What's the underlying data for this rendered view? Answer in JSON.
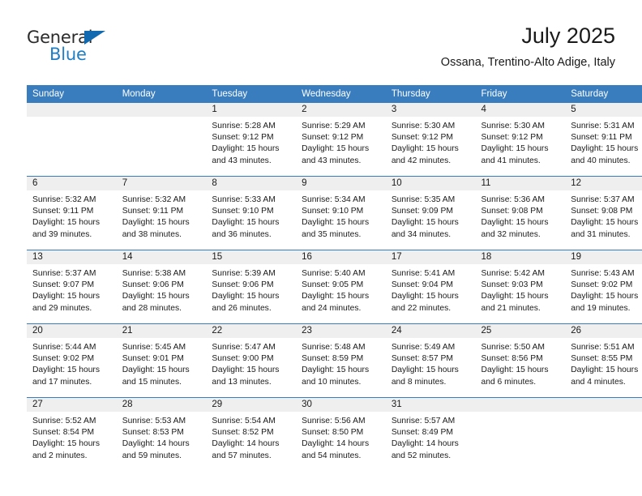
{
  "logo": {
    "word1": "General",
    "word2": "Blue",
    "triangle_color": "#1169b0",
    "blue_color": "#1f7ec4"
  },
  "header": {
    "title": "July 2025",
    "subtitle": "Ossana, Trentino-Alto Adige, Italy"
  },
  "theme": {
    "header_band": "#3a7dbf",
    "daynum_band": "#efefef",
    "text": "#1a1a1a"
  },
  "weekdays": [
    "Sunday",
    "Monday",
    "Tuesday",
    "Wednesday",
    "Thursday",
    "Friday",
    "Saturday"
  ],
  "weeks": [
    [
      {
        "day": "",
        "lines": []
      },
      {
        "day": "",
        "lines": []
      },
      {
        "day": "1",
        "lines": [
          "Sunrise: 5:28 AM",
          "Sunset: 9:12 PM",
          "Daylight: 15 hours and 43 minutes."
        ]
      },
      {
        "day": "2",
        "lines": [
          "Sunrise: 5:29 AM",
          "Sunset: 9:12 PM",
          "Daylight: 15 hours and 43 minutes."
        ]
      },
      {
        "day": "3",
        "lines": [
          "Sunrise: 5:30 AM",
          "Sunset: 9:12 PM",
          "Daylight: 15 hours and 42 minutes."
        ]
      },
      {
        "day": "4",
        "lines": [
          "Sunrise: 5:30 AM",
          "Sunset: 9:12 PM",
          "Daylight: 15 hours and 41 minutes."
        ]
      },
      {
        "day": "5",
        "lines": [
          "Sunrise: 5:31 AM",
          "Sunset: 9:11 PM",
          "Daylight: 15 hours and 40 minutes."
        ]
      }
    ],
    [
      {
        "day": "6",
        "lines": [
          "Sunrise: 5:32 AM",
          "Sunset: 9:11 PM",
          "Daylight: 15 hours and 39 minutes."
        ]
      },
      {
        "day": "7",
        "lines": [
          "Sunrise: 5:32 AM",
          "Sunset: 9:11 PM",
          "Daylight: 15 hours and 38 minutes."
        ]
      },
      {
        "day": "8",
        "lines": [
          "Sunrise: 5:33 AM",
          "Sunset: 9:10 PM",
          "Daylight: 15 hours and 36 minutes."
        ]
      },
      {
        "day": "9",
        "lines": [
          "Sunrise: 5:34 AM",
          "Sunset: 9:10 PM",
          "Daylight: 15 hours and 35 minutes."
        ]
      },
      {
        "day": "10",
        "lines": [
          "Sunrise: 5:35 AM",
          "Sunset: 9:09 PM",
          "Daylight: 15 hours and 34 minutes."
        ]
      },
      {
        "day": "11",
        "lines": [
          "Sunrise: 5:36 AM",
          "Sunset: 9:08 PM",
          "Daylight: 15 hours and 32 minutes."
        ]
      },
      {
        "day": "12",
        "lines": [
          "Sunrise: 5:37 AM",
          "Sunset: 9:08 PM",
          "Daylight: 15 hours and 31 minutes."
        ]
      }
    ],
    [
      {
        "day": "13",
        "lines": [
          "Sunrise: 5:37 AM",
          "Sunset: 9:07 PM",
          "Daylight: 15 hours and 29 minutes."
        ]
      },
      {
        "day": "14",
        "lines": [
          "Sunrise: 5:38 AM",
          "Sunset: 9:06 PM",
          "Daylight: 15 hours and 28 minutes."
        ]
      },
      {
        "day": "15",
        "lines": [
          "Sunrise: 5:39 AM",
          "Sunset: 9:06 PM",
          "Daylight: 15 hours and 26 minutes."
        ]
      },
      {
        "day": "16",
        "lines": [
          "Sunrise: 5:40 AM",
          "Sunset: 9:05 PM",
          "Daylight: 15 hours and 24 minutes."
        ]
      },
      {
        "day": "17",
        "lines": [
          "Sunrise: 5:41 AM",
          "Sunset: 9:04 PM",
          "Daylight: 15 hours and 22 minutes."
        ]
      },
      {
        "day": "18",
        "lines": [
          "Sunrise: 5:42 AM",
          "Sunset: 9:03 PM",
          "Daylight: 15 hours and 21 minutes."
        ]
      },
      {
        "day": "19",
        "lines": [
          "Sunrise: 5:43 AM",
          "Sunset: 9:02 PM",
          "Daylight: 15 hours and 19 minutes."
        ]
      }
    ],
    [
      {
        "day": "20",
        "lines": [
          "Sunrise: 5:44 AM",
          "Sunset: 9:02 PM",
          "Daylight: 15 hours and 17 minutes."
        ]
      },
      {
        "day": "21",
        "lines": [
          "Sunrise: 5:45 AM",
          "Sunset: 9:01 PM",
          "Daylight: 15 hours and 15 minutes."
        ]
      },
      {
        "day": "22",
        "lines": [
          "Sunrise: 5:47 AM",
          "Sunset: 9:00 PM",
          "Daylight: 15 hours and 13 minutes."
        ]
      },
      {
        "day": "23",
        "lines": [
          "Sunrise: 5:48 AM",
          "Sunset: 8:59 PM",
          "Daylight: 15 hours and 10 minutes."
        ]
      },
      {
        "day": "24",
        "lines": [
          "Sunrise: 5:49 AM",
          "Sunset: 8:57 PM",
          "Daylight: 15 hours and 8 minutes."
        ]
      },
      {
        "day": "25",
        "lines": [
          "Sunrise: 5:50 AM",
          "Sunset: 8:56 PM",
          "Daylight: 15 hours and 6 minutes."
        ]
      },
      {
        "day": "26",
        "lines": [
          "Sunrise: 5:51 AM",
          "Sunset: 8:55 PM",
          "Daylight: 15 hours and 4 minutes."
        ]
      }
    ],
    [
      {
        "day": "27",
        "lines": [
          "Sunrise: 5:52 AM",
          "Sunset: 8:54 PM",
          "Daylight: 15 hours and 2 minutes."
        ]
      },
      {
        "day": "28",
        "lines": [
          "Sunrise: 5:53 AM",
          "Sunset: 8:53 PM",
          "Daylight: 14 hours and 59 minutes."
        ]
      },
      {
        "day": "29",
        "lines": [
          "Sunrise: 5:54 AM",
          "Sunset: 8:52 PM",
          "Daylight: 14 hours and 57 minutes."
        ]
      },
      {
        "day": "30",
        "lines": [
          "Sunrise: 5:56 AM",
          "Sunset: 8:50 PM",
          "Daylight: 14 hours and 54 minutes."
        ]
      },
      {
        "day": "31",
        "lines": [
          "Sunrise: 5:57 AM",
          "Sunset: 8:49 PM",
          "Daylight: 14 hours and 52 minutes."
        ]
      },
      {
        "day": "",
        "lines": []
      },
      {
        "day": "",
        "lines": []
      }
    ]
  ]
}
